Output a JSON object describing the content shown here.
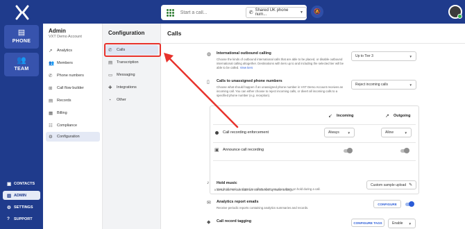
{
  "topbar": {
    "logo_icon": "x-logo-icon",
    "call_placeholder": "Start a call...",
    "line_label": "Shared UK phone num...",
    "dnd_icon": "bell-off-icon",
    "avatar": "user-avatar"
  },
  "left_nav": {
    "tiles": [
      {
        "label": "PHONE",
        "icon": "chat-icon"
      },
      {
        "label": "TEAM",
        "icon": "team-icon"
      }
    ],
    "bottom": [
      {
        "label": "CONTACTS",
        "icon": "contacts-icon"
      },
      {
        "label": "ADMIN",
        "icon": "bar-chart-icon"
      },
      {
        "label": "SETTINGS",
        "icon": "gear-icon"
      },
      {
        "label": "SUPPORT",
        "icon": "help-icon"
      }
    ]
  },
  "admin": {
    "title": "Admin",
    "subtitle": "VXT Demo Account",
    "items": [
      {
        "label": "Analytics",
        "icon": "trend-icon"
      },
      {
        "label": "Members",
        "icon": "members-icon"
      },
      {
        "label": "Phone numbers",
        "icon": "phone-icon"
      },
      {
        "label": "Call flow builder",
        "icon": "flow-icon"
      },
      {
        "label": "Records",
        "icon": "records-icon"
      },
      {
        "label": "Billing",
        "icon": "billing-icon"
      },
      {
        "label": "Compliance",
        "icon": "compliance-icon"
      },
      {
        "label": "Configuration",
        "icon": "gear-icon"
      }
    ]
  },
  "config": {
    "title": "Configuration",
    "items": [
      {
        "label": "Calls",
        "icon": "phone-icon"
      },
      {
        "label": "Transcription",
        "icon": "transcription-icon"
      },
      {
        "label": "Messaging",
        "icon": "message-icon"
      },
      {
        "label": "Integrations",
        "icon": "puzzle-icon"
      },
      {
        "label": "Other",
        "icon": "other-icon"
      }
    ]
  },
  "main": {
    "title": "Calls",
    "intl": {
      "title": "International outbound calling",
      "desc1": "Choose the kinds of outbound international calls that are able to be placed, or disable",
      "desc2": "outbound international calling altogether. Destinations with tiers up to and including the",
      "desc3": "selected tier will be able to be called.",
      "link": "View tiers",
      "value": "Up to Tier 3"
    },
    "unassigned": {
      "title": "Calls to unassigned phone numbers",
      "desc1": "Choose what should happen if an unassigned phone number in VXT Demo Account",
      "desc2": "receives an incoming call. You can either choose to reject incoming calls, or divert all",
      "desc3": "incoming calls to a specified phone number (e.g. reception).",
      "value": "Reject incoming calls"
    },
    "recording": {
      "incoming": "Incoming",
      "outgoing": "Outgoing",
      "enforcement_label": "Call recording enforcement",
      "incoming_value": "Always",
      "outgoing_value": "Allow",
      "announce_label": "Announce call recording",
      "note": "Internal user-to-user calls are not affected by these settings."
    },
    "hold": {
      "title": "Hold music",
      "desc": "Your hold music is played to callers when you place them on hold during a call.",
      "button": "Custom sample upload"
    },
    "analytics": {
      "title": "Analytics report emails",
      "desc": "Receive periodic reports containing analytics summaries and records.",
      "button": "CONFIGURE"
    },
    "tagging": {
      "title": "Call record tagging",
      "button": "CONFIGURE TAGS",
      "value": "Enable"
    }
  },
  "colors": {
    "brand": "#1f3b8c",
    "accent": "#2a5bd7",
    "highlight": "#e8322c",
    "status": "#2db34a"
  }
}
